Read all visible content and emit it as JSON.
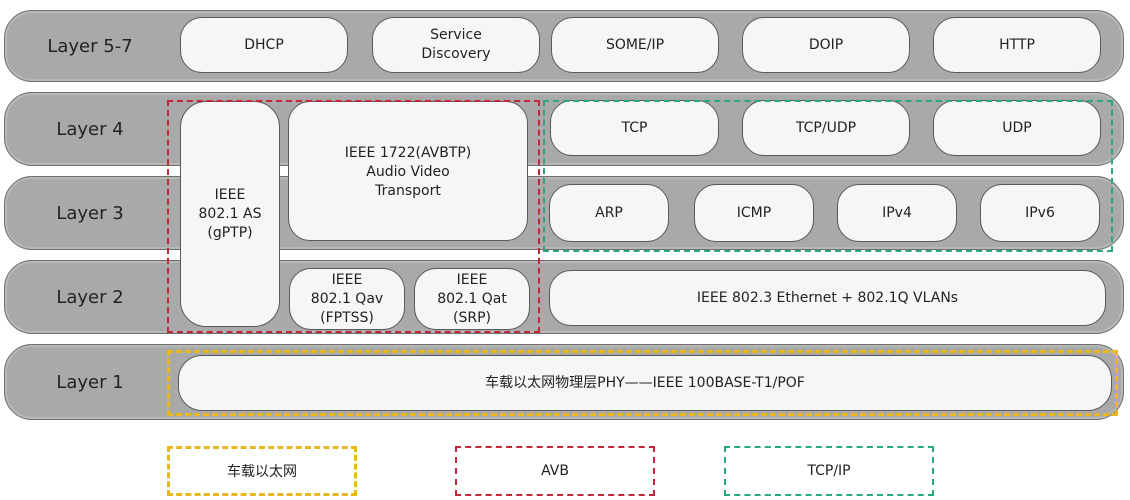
{
  "layers": [
    {
      "label": "Layer 5-7"
    },
    {
      "label": "Layer 4"
    },
    {
      "label": "Layer 3"
    },
    {
      "label": "Layer 2"
    },
    {
      "label": "Layer 1"
    }
  ],
  "layer57": {
    "protocols": [
      "DHCP",
      "Service\nDiscovery",
      "SOME/IP",
      "DOIP",
      "HTTP"
    ]
  },
  "avb": {
    "gptp": "IEEE\n802.1 AS\n(gPTP)",
    "avbtp": "IEEE 1722(AVBTP)\nAudio Video\nTransport",
    "qav": "IEEE\n802.1 Qav\n(FPTSS)",
    "qat": "IEEE\n802.1 Qat\n(SRP)"
  },
  "layer4": {
    "protocols": [
      "TCP",
      "TCP/UDP",
      "UDP"
    ]
  },
  "layer3": {
    "protocols": [
      "ARP",
      "ICMP",
      "IPv4",
      "IPv6"
    ]
  },
  "layer2": {
    "ethernet": "IEEE 802.3 Ethernet + 802.1Q VLANs"
  },
  "layer1": {
    "phy": "车载以太网物理层PHY——IEEE 100BASE-T1/POF"
  },
  "legend": [
    {
      "label": "车载以太网",
      "color": "#e8b820"
    },
    {
      "label": "AVB",
      "color": "#c0283a"
    },
    {
      "label": "TCP/IP",
      "color": "#2aa878"
    }
  ]
}
